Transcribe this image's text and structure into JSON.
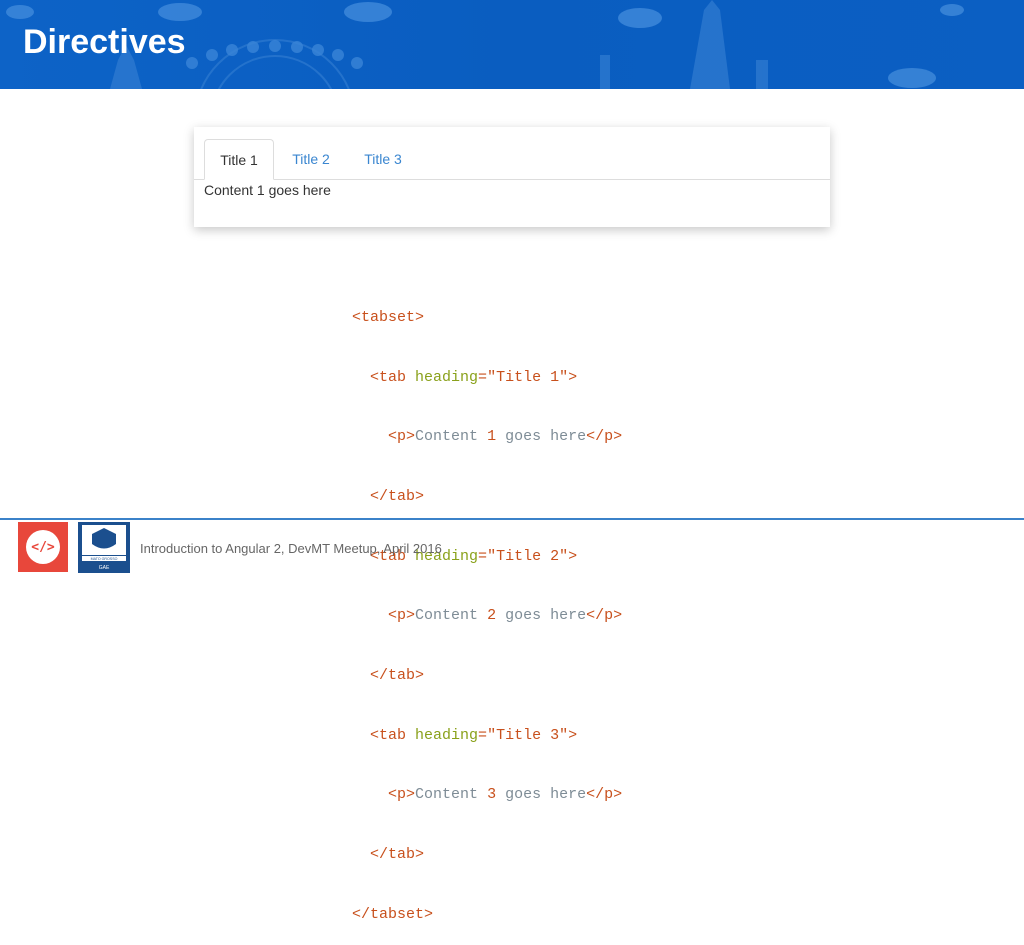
{
  "slide": {
    "title": "Directives"
  },
  "demo_tabs": {
    "tabs": [
      {
        "label": "Title 1",
        "active": true
      },
      {
        "label": "Title 2",
        "active": false
      },
      {
        "label": "Title 3",
        "active": false
      }
    ],
    "content": "Content 1 goes here"
  },
  "code": {
    "tabset_open": "<tabset>",
    "tabset_close": "</tabset>",
    "tab_open_prefix": "<tab ",
    "heading_attr": "heading",
    "equals": "=",
    "tab_open_suffix": ">",
    "tab_close": "</tab>",
    "p_open": "<p>",
    "p_close": "</p>",
    "content_word": "Content",
    "content_rest": "goes here",
    "tabs": [
      {
        "heading": "\"Title 1\"",
        "number": "1"
      },
      {
        "heading": "\"Title 2\"",
        "number": "2"
      },
      {
        "heading": "\"Title 3\"",
        "number": "3"
      }
    ]
  },
  "footer": {
    "text": "Introduction to Angular 2, DevMT Meetup, April 2016",
    "devmt_logo_text": "</>",
    "ufmt_logo_text": "MATO GROSSO",
    "ufmt_logo_sub": "GAE"
  },
  "colors": {
    "banner": "#0b5fc3",
    "accent_line": "#3b82c9",
    "tab_link": "#3a86d0",
    "code_tag": "#c8501c",
    "code_attr": "#8aa11b",
    "devmt_red": "#e8473b"
  }
}
